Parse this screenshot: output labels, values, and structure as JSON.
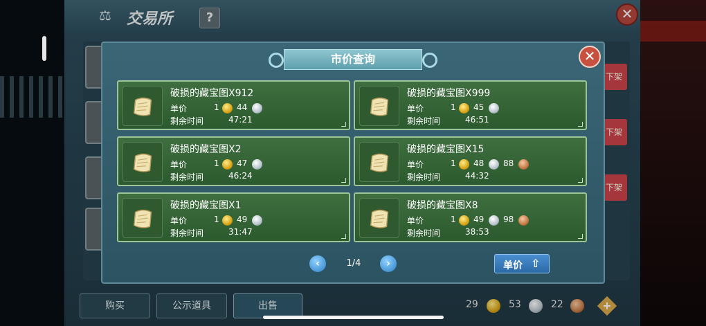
{
  "background": {
    "window_title": "交易所",
    "help_label": "?",
    "close_label": "✕",
    "delist_label": "下架",
    "bottom_tabs": [
      "购买",
      "公示道具",
      "出售"
    ],
    "currency": {
      "gold": "29",
      "silver": "53",
      "bronze": "22",
      "add_label": "+"
    }
  },
  "modal": {
    "title": "市价查询",
    "close_label": "✕",
    "unit_price_label": "单价",
    "remaining_label": "剩余时间",
    "listings": [
      {
        "name": "破损的藏宝图X912",
        "gold": "1",
        "silver": "44",
        "bronze": null,
        "time": "47:21"
      },
      {
        "name": "破损的藏宝图X999",
        "gold": "1",
        "silver": "45",
        "bronze": null,
        "time": "46:51"
      },
      {
        "name": "破损的藏宝图X2",
        "gold": "1",
        "silver": "47",
        "bronze": null,
        "time": "46:24"
      },
      {
        "name": "破损的藏宝图X15",
        "gold": "1",
        "silver": "48",
        "bronze": "88",
        "time": "44:32"
      },
      {
        "name": "破损的藏宝图X1",
        "gold": "1",
        "silver": "49",
        "bronze": null,
        "time": "31:47"
      },
      {
        "name": "破损的藏宝图X8",
        "gold": "1",
        "silver": "49",
        "bronze": "98",
        "time": "38:53"
      }
    ],
    "pagination": {
      "page": "1/4",
      "prev": "‹",
      "next": "›"
    },
    "sort_button": {
      "label": "单价",
      "icon": "arrow-icon"
    }
  },
  "colors": {
    "listing_bg": "#3f6e3f",
    "modal_bg": "#3b6676",
    "accent_blue": "#2c6aa6",
    "close_red": "#c8503f"
  }
}
